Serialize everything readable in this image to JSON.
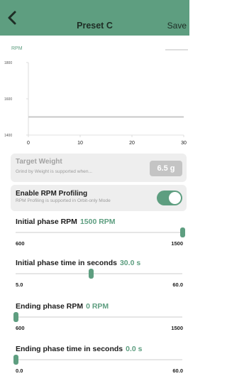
{
  "header": {
    "title": "Preset C",
    "save_label": "Save"
  },
  "chart_data": {
    "type": "line",
    "ylabel": "RPM",
    "xlim": [
      0,
      30
    ],
    "ylim": [
      1400,
      1800
    ],
    "x_ticks": [
      "0",
      "10",
      "20",
      "30"
    ],
    "y_ticks": [
      "1400",
      "1600",
      "1800"
    ],
    "series": [
      {
        "x": [
          0,
          30
        ],
        "y": [
          1500,
          1500
        ]
      }
    ],
    "line_color": "#c8c8c8"
  },
  "target_weight": {
    "title": "Target Weight",
    "subtitle": "Grind by Weight is supported when...",
    "value": "6.5 g",
    "enabled": false
  },
  "rpm_profiling": {
    "title": "Enable RPM Profiling",
    "subtitle": "RPM Profiling is supported in Orbit-only Mode",
    "enabled": true
  },
  "sliders": [
    {
      "label": "Initial phase RPM",
      "value_text": "1500 RPM",
      "min": "600",
      "max": "1500",
      "fraction": 1.0
    },
    {
      "label": "Initial phase time in seconds",
      "value_text": "30.0 s",
      "min": "5.0",
      "max": "60.0",
      "fraction": 0.4545
    },
    {
      "label": "Ending phase RPM",
      "value_text": "0 RPM",
      "min": "600",
      "max": "1500",
      "fraction": 0.0
    },
    {
      "label": "Ending phase time in seconds",
      "value_text": "0.0 s",
      "min": "0.0",
      "max": "60.0",
      "fraction": 0.0
    }
  ],
  "colors": {
    "accent": "#5e9e80",
    "disabled_badge": "#c4c4c4",
    "card": "#eeeeee"
  }
}
